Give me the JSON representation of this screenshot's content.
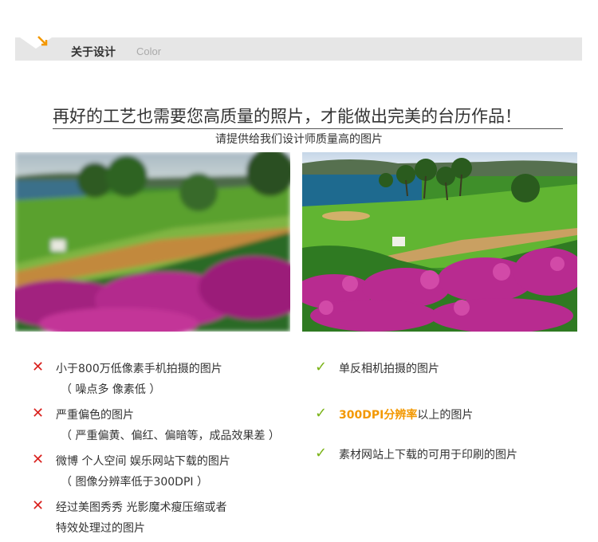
{
  "header": {
    "title": "关于设计",
    "subtitle": "Color"
  },
  "headline": "再好的工艺也需要您高质量的照片，才能做出完美的台历作品！",
  "subline": "请提供给我们设计师质量高的图片",
  "bad_items": [
    {
      "line1": "小于800万低像素手机拍摄的图片",
      "line2": "（ 噪点多 像素低 ）"
    },
    {
      "line1": "严重偏色的图片",
      "line2": "（ 严重偏黄、偏红、偏暗等，成品效果差 ）"
    },
    {
      "line1": "微博 个人空间 娱乐网站下载的图片",
      "line2": "（ 图像分辨率低于300DPI ）"
    },
    {
      "line1": "经过美图秀秀 光影魔术瘦压缩或者",
      "line2": "特效处理过的图片"
    }
  ],
  "good_items": [
    {
      "line1": "单反相机拍摄的图片"
    },
    {
      "highlight": "300DPI分辨率",
      "rest": "以上的图片"
    },
    {
      "line1": "素材网站上下载的可用于印刷的图片"
    }
  ],
  "marks": {
    "bad": "✕",
    "good": "✓"
  },
  "colors": {
    "bad": "#d9211e",
    "good": "#7ab317",
    "highlight": "#f39800"
  },
  "icons": {
    "header": "orange-arrow-icon"
  }
}
